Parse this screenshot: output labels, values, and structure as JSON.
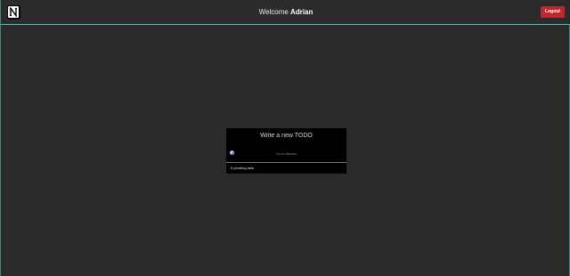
{
  "header": {
    "welcome_prefix": "Welcome",
    "user_name": "Adrian",
    "logout_label": "Logout",
    "logout_color": "#c0272d",
    "logo_icon": "notion-logo-icon"
  },
  "todo": {
    "title": "Write a new TODO",
    "input_placeholder": "Go to Mexico",
    "pending_text": "0 pending task"
  },
  "colors": {
    "background": "#2a2a2a",
    "header_border": "#58c2c2",
    "card_background": "#000000"
  }
}
